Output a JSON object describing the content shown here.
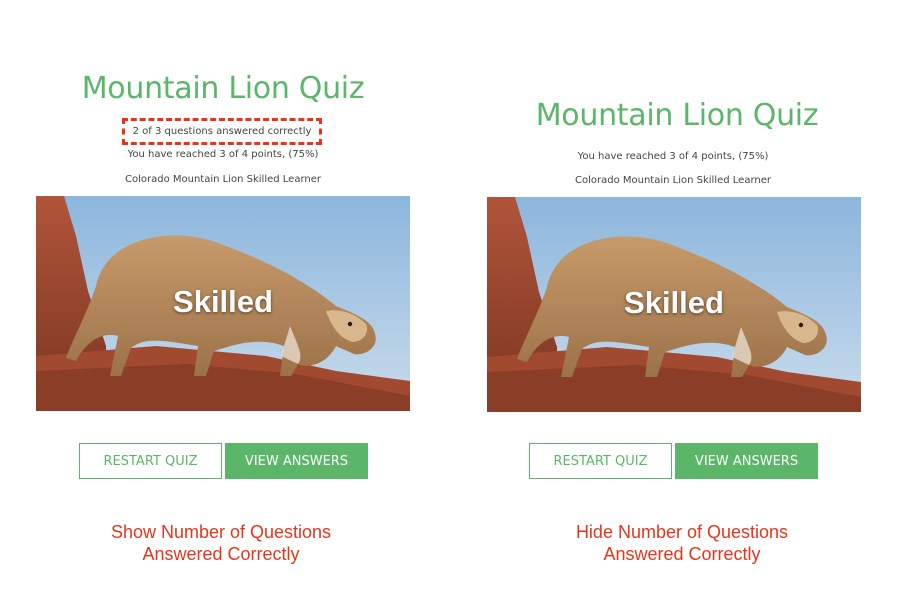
{
  "left_panel": {
    "title": "Mountain Lion Quiz",
    "correct_count_text": "2 of 3 questions answered correctly",
    "points_text": "You have reached 3 of 4 points, (75%)",
    "learner_text": "Colorado Mountain Lion Skilled Learner",
    "image_overlay_text": "Skilled",
    "restart_label": "RESTART QUIZ",
    "view_answers_label": "VIEW ANSWERS",
    "caption_line1": "Show Number of Questions",
    "caption_line2": "Answered Correctly"
  },
  "right_panel": {
    "title": "Mountain Lion Quiz",
    "points_text": "You have reached 3 of 4 points, (75%)",
    "learner_text": "Colorado Mountain Lion Skilled Learner",
    "image_overlay_text": "Skilled",
    "restart_label": "RESTART QUIZ",
    "view_answers_label": "VIEW ANSWERS",
    "caption_line1": "Hide Number of Questions",
    "caption_line2": "Answered Correctly"
  },
  "colors": {
    "accent_green": "#5cb66a",
    "caption_red": "#e8341c",
    "highlight_dashed_border": "#e8341c"
  }
}
